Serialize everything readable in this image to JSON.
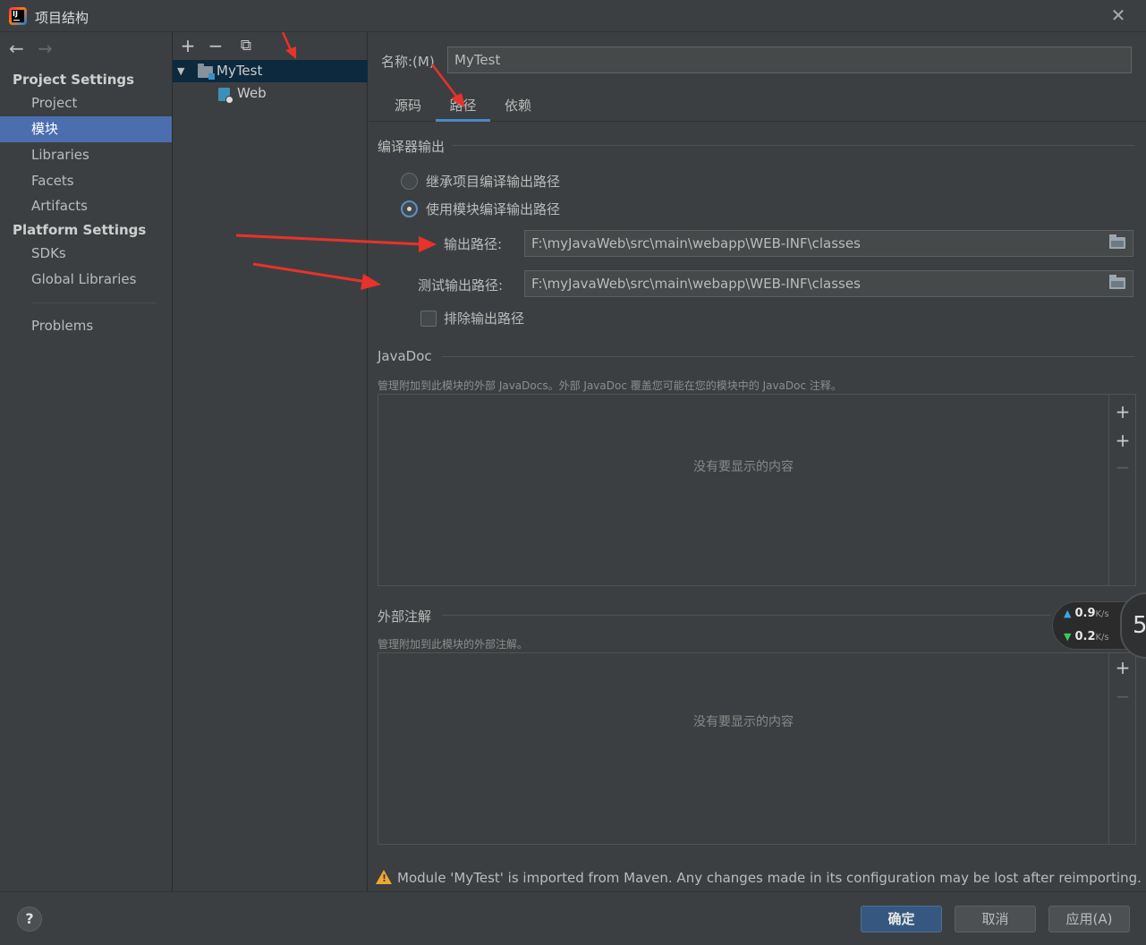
{
  "window": {
    "title": "项目结构",
    "close_glyph": "✕"
  },
  "nav": {
    "back_glyph": "←",
    "forward_glyph": "→",
    "sections": [
      {
        "title": "Project Settings",
        "items": [
          "Project",
          "模块",
          "Libraries",
          "Facets",
          "Artifacts"
        ]
      },
      {
        "title": "Platform Settings",
        "items": [
          "SDKs",
          "Global Libraries"
        ]
      }
    ],
    "problems": "Problems",
    "selected": "模块"
  },
  "tree": {
    "toolbar": {
      "add": "+",
      "remove": "−",
      "copy": "⧉"
    },
    "nodes": [
      {
        "label": "MyTest",
        "expanded": true,
        "icon": "module-folder-icon"
      },
      {
        "label": "Web",
        "icon": "web-facet-icon"
      }
    ]
  },
  "module": {
    "name_label": "名称:(M)",
    "name_value": "MyTest",
    "tabs": [
      "源码",
      "路径",
      "依赖"
    ],
    "selected_tab": "路径",
    "compiler_output": {
      "title": "编译器输出",
      "options": [
        "继承项目编译输出路径",
        "使用模块编译输出路径"
      ],
      "selected_option": "使用模块编译输出路径",
      "output_label": "输出路径:",
      "output_value": "F:\\myJavaWeb\\src\\main\\webapp\\WEB-INF\\classes",
      "test_output_label": "测试输出路径:",
      "test_output_value": "F:\\myJavaWeb\\src\\main\\webapp\\WEB-INF\\classes",
      "exclude_label": "排除输出路径",
      "exclude_checked": false
    },
    "javadoc": {
      "title": "JavaDoc",
      "description": "管理附加到此模块的外部 JavaDocs。外部 JavaDoc 覆盖您可能在您的模块中的 JavaDoc 注释。",
      "empty_text": "没有要显示的内容",
      "buttons": [
        "+",
        "+",
        "−"
      ]
    },
    "annotations": {
      "title": "外部注解",
      "description": "管理附加到此模块的外部注解。",
      "empty_text": "没有要显示的内容",
      "buttons": [
        "+",
        "−"
      ]
    },
    "warning": "Module 'MyTest' is imported from Maven. Any changes made in its configuration may be lost after reimporting."
  },
  "speed_widget": {
    "upload": "0.9",
    "download": "0.2",
    "unit": "K/s",
    "circle_value": "5"
  },
  "footer": {
    "help": "?",
    "ok": "确定",
    "cancel": "取消",
    "apply": "应用(A)"
  },
  "colors": {
    "accent": "#4b6eaf",
    "tab_underline": "#4a88c7",
    "annotation_red": "#e8322a",
    "warning": "#f0a732"
  }
}
